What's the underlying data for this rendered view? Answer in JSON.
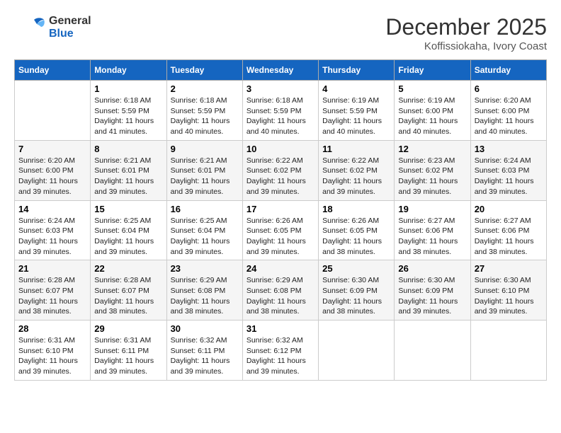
{
  "logo": {
    "line1": "General",
    "line2": "Blue"
  },
  "title": "December 2025",
  "location": "Koffissiokaha, Ivory Coast",
  "days_header": [
    "Sunday",
    "Monday",
    "Tuesday",
    "Wednesday",
    "Thursday",
    "Friday",
    "Saturday"
  ],
  "weeks": [
    [
      {
        "day": "",
        "sunrise": "",
        "sunset": "",
        "daylight": ""
      },
      {
        "day": "1",
        "sunrise": "6:18 AM",
        "sunset": "5:59 PM",
        "daylight": "11 hours and 41 minutes."
      },
      {
        "day": "2",
        "sunrise": "6:18 AM",
        "sunset": "5:59 PM",
        "daylight": "11 hours and 40 minutes."
      },
      {
        "day": "3",
        "sunrise": "6:18 AM",
        "sunset": "5:59 PM",
        "daylight": "11 hours and 40 minutes."
      },
      {
        "day": "4",
        "sunrise": "6:19 AM",
        "sunset": "5:59 PM",
        "daylight": "11 hours and 40 minutes."
      },
      {
        "day": "5",
        "sunrise": "6:19 AM",
        "sunset": "6:00 PM",
        "daylight": "11 hours and 40 minutes."
      },
      {
        "day": "6",
        "sunrise": "6:20 AM",
        "sunset": "6:00 PM",
        "daylight": "11 hours and 40 minutes."
      }
    ],
    [
      {
        "day": "7",
        "sunrise": "6:20 AM",
        "sunset": "6:00 PM",
        "daylight": "11 hours and 39 minutes."
      },
      {
        "day": "8",
        "sunrise": "6:21 AM",
        "sunset": "6:01 PM",
        "daylight": "11 hours and 39 minutes."
      },
      {
        "day": "9",
        "sunrise": "6:21 AM",
        "sunset": "6:01 PM",
        "daylight": "11 hours and 39 minutes."
      },
      {
        "day": "10",
        "sunrise": "6:22 AM",
        "sunset": "6:02 PM",
        "daylight": "11 hours and 39 minutes."
      },
      {
        "day": "11",
        "sunrise": "6:22 AM",
        "sunset": "6:02 PM",
        "daylight": "11 hours and 39 minutes."
      },
      {
        "day": "12",
        "sunrise": "6:23 AM",
        "sunset": "6:02 PM",
        "daylight": "11 hours and 39 minutes."
      },
      {
        "day": "13",
        "sunrise": "6:24 AM",
        "sunset": "6:03 PM",
        "daylight": "11 hours and 39 minutes."
      }
    ],
    [
      {
        "day": "14",
        "sunrise": "6:24 AM",
        "sunset": "6:03 PM",
        "daylight": "11 hours and 39 minutes."
      },
      {
        "day": "15",
        "sunrise": "6:25 AM",
        "sunset": "6:04 PM",
        "daylight": "11 hours and 39 minutes."
      },
      {
        "day": "16",
        "sunrise": "6:25 AM",
        "sunset": "6:04 PM",
        "daylight": "11 hours and 39 minutes."
      },
      {
        "day": "17",
        "sunrise": "6:26 AM",
        "sunset": "6:05 PM",
        "daylight": "11 hours and 39 minutes."
      },
      {
        "day": "18",
        "sunrise": "6:26 AM",
        "sunset": "6:05 PM",
        "daylight": "11 hours and 38 minutes."
      },
      {
        "day": "19",
        "sunrise": "6:27 AM",
        "sunset": "6:06 PM",
        "daylight": "11 hours and 38 minutes."
      },
      {
        "day": "20",
        "sunrise": "6:27 AM",
        "sunset": "6:06 PM",
        "daylight": "11 hours and 38 minutes."
      }
    ],
    [
      {
        "day": "21",
        "sunrise": "6:28 AM",
        "sunset": "6:07 PM",
        "daylight": "11 hours and 38 minutes."
      },
      {
        "day": "22",
        "sunrise": "6:28 AM",
        "sunset": "6:07 PM",
        "daylight": "11 hours and 38 minutes."
      },
      {
        "day": "23",
        "sunrise": "6:29 AM",
        "sunset": "6:08 PM",
        "daylight": "11 hours and 38 minutes."
      },
      {
        "day": "24",
        "sunrise": "6:29 AM",
        "sunset": "6:08 PM",
        "daylight": "11 hours and 38 minutes."
      },
      {
        "day": "25",
        "sunrise": "6:30 AM",
        "sunset": "6:09 PM",
        "daylight": "11 hours and 38 minutes."
      },
      {
        "day": "26",
        "sunrise": "6:30 AM",
        "sunset": "6:09 PM",
        "daylight": "11 hours and 39 minutes."
      },
      {
        "day": "27",
        "sunrise": "6:30 AM",
        "sunset": "6:10 PM",
        "daylight": "11 hours and 39 minutes."
      }
    ],
    [
      {
        "day": "28",
        "sunrise": "6:31 AM",
        "sunset": "6:10 PM",
        "daylight": "11 hours and 39 minutes."
      },
      {
        "day": "29",
        "sunrise": "6:31 AM",
        "sunset": "6:11 PM",
        "daylight": "11 hours and 39 minutes."
      },
      {
        "day": "30",
        "sunrise": "6:32 AM",
        "sunset": "6:11 PM",
        "daylight": "11 hours and 39 minutes."
      },
      {
        "day": "31",
        "sunrise": "6:32 AM",
        "sunset": "6:12 PM",
        "daylight": "11 hours and 39 minutes."
      },
      {
        "day": "",
        "sunrise": "",
        "sunset": "",
        "daylight": ""
      },
      {
        "day": "",
        "sunrise": "",
        "sunset": "",
        "daylight": ""
      },
      {
        "day": "",
        "sunrise": "",
        "sunset": "",
        "daylight": ""
      }
    ]
  ]
}
